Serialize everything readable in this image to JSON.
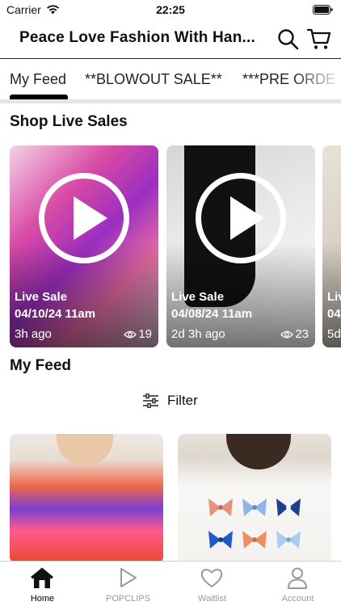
{
  "status_bar": {
    "carrier": "Carrier",
    "time": "22:25"
  },
  "header": {
    "title": "Peace Love Fashion With Han...",
    "search_icon": "search-icon",
    "cart_icon": "cart-icon"
  },
  "tabs": [
    {
      "label": "My Feed",
      "active": true
    },
    {
      "label": "**BLOWOUT SALE**",
      "active": false
    },
    {
      "label": "***PRE ORDE",
      "active": false
    }
  ],
  "sections": {
    "live_sales": "Shop Live Sales",
    "my_feed": "My Feed"
  },
  "live_sales": [
    {
      "label": "Live Sale",
      "date": "04/10/24 11am",
      "ago": "3h ago",
      "views": "19"
    },
    {
      "label": "Live Sale",
      "date": "04/08/24 11am",
      "ago": "2d 3h ago",
      "views": "23"
    },
    {
      "label": "Liv",
      "date": "04/",
      "ago": "5d",
      "views": ""
    }
  ],
  "filter": {
    "label": "Filter",
    "icon": "sliders-icon"
  },
  "tab_bar": [
    {
      "label": "Home",
      "icon": "home-icon",
      "active": true
    },
    {
      "label": "POPCLIPS",
      "icon": "play-icon",
      "active": false
    },
    {
      "label": "Waitlist",
      "icon": "heart-icon",
      "active": false
    },
    {
      "label": "Account",
      "icon": "person-icon",
      "active": false
    }
  ],
  "colors": {
    "accent": "#000000",
    "inactive": "#9a9a9a",
    "divider": "#e4e4e4"
  }
}
